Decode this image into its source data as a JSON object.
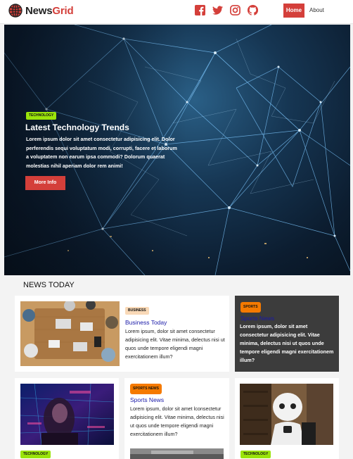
{
  "navbar": {
    "brand_prefix": "News",
    "brand_suffix": "Grid",
    "social_icons": [
      "facebook-icon",
      "twitter-icon",
      "instagram-icon",
      "github-icon"
    ],
    "home_label": "Home",
    "about_label": "About",
    "accent_color": "#d43f3a"
  },
  "hero": {
    "tag": "TECHNOLOGY",
    "title": "Latest Technology Trends",
    "text": "Lorem ipsum dolor sit amet consectetur adipisicing elit. Dolor perferendis sequi voluptatum modi, corrupti, facere et laborum a voluptatem non earum ipsa commodi? Dolorum quaerat molestias nihil aperiam dolor rem animi!",
    "button_label": "More Info"
  },
  "news_today": {
    "heading": "NEWS TODAY",
    "cards": [
      {
        "tag": "BUSINESS",
        "title": "Business Today",
        "text": "Lorem ipsum, dolor sit amet consectetur adipisicing elit. Vitae minima, delectus nisi ut quos unde tempore eligendi magni exercitationem illum?"
      },
      {
        "tag": "SPORTS",
        "title": "Sports News",
        "text": "Lorem ipsum, dolor sit amet consectetur adipisicing elit. Vitae minima, delectus nisi ut quos unde tempore eligendi magni exercitationem illum?"
      },
      {
        "tag": "TECHNOLOGY"
      },
      {
        "tag": "SPORTS NEWS",
        "title": "Sports News",
        "text": "Lorem ipsum, dolor sit amet lconsectetur adipisicing elit. Vitae minima, delectus nisi ut quos unde tempore eligendi magni exercitationem illum?"
      },
      {
        "tag": "TECHNOLOGY"
      }
    ]
  }
}
